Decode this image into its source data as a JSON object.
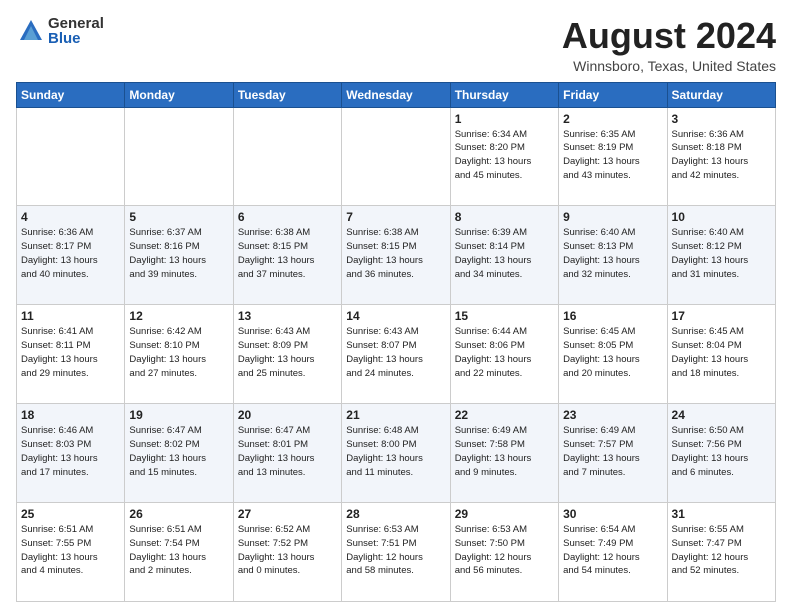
{
  "logo": {
    "general": "General",
    "blue": "Blue"
  },
  "title": "August 2024",
  "location": "Winnsboro, Texas, United States",
  "weekdays": [
    "Sunday",
    "Monday",
    "Tuesday",
    "Wednesday",
    "Thursday",
    "Friday",
    "Saturday"
  ],
  "weeks": [
    [
      {
        "day": "",
        "info": ""
      },
      {
        "day": "",
        "info": ""
      },
      {
        "day": "",
        "info": ""
      },
      {
        "day": "",
        "info": ""
      },
      {
        "day": "1",
        "info": "Sunrise: 6:34 AM\nSunset: 8:20 PM\nDaylight: 13 hours\nand 45 minutes."
      },
      {
        "day": "2",
        "info": "Sunrise: 6:35 AM\nSunset: 8:19 PM\nDaylight: 13 hours\nand 43 minutes."
      },
      {
        "day": "3",
        "info": "Sunrise: 6:36 AM\nSunset: 8:18 PM\nDaylight: 13 hours\nand 42 minutes."
      }
    ],
    [
      {
        "day": "4",
        "info": "Sunrise: 6:36 AM\nSunset: 8:17 PM\nDaylight: 13 hours\nand 40 minutes."
      },
      {
        "day": "5",
        "info": "Sunrise: 6:37 AM\nSunset: 8:16 PM\nDaylight: 13 hours\nand 39 minutes."
      },
      {
        "day": "6",
        "info": "Sunrise: 6:38 AM\nSunset: 8:15 PM\nDaylight: 13 hours\nand 37 minutes."
      },
      {
        "day": "7",
        "info": "Sunrise: 6:38 AM\nSunset: 8:15 PM\nDaylight: 13 hours\nand 36 minutes."
      },
      {
        "day": "8",
        "info": "Sunrise: 6:39 AM\nSunset: 8:14 PM\nDaylight: 13 hours\nand 34 minutes."
      },
      {
        "day": "9",
        "info": "Sunrise: 6:40 AM\nSunset: 8:13 PM\nDaylight: 13 hours\nand 32 minutes."
      },
      {
        "day": "10",
        "info": "Sunrise: 6:40 AM\nSunset: 8:12 PM\nDaylight: 13 hours\nand 31 minutes."
      }
    ],
    [
      {
        "day": "11",
        "info": "Sunrise: 6:41 AM\nSunset: 8:11 PM\nDaylight: 13 hours\nand 29 minutes."
      },
      {
        "day": "12",
        "info": "Sunrise: 6:42 AM\nSunset: 8:10 PM\nDaylight: 13 hours\nand 27 minutes."
      },
      {
        "day": "13",
        "info": "Sunrise: 6:43 AM\nSunset: 8:09 PM\nDaylight: 13 hours\nand 25 minutes."
      },
      {
        "day": "14",
        "info": "Sunrise: 6:43 AM\nSunset: 8:07 PM\nDaylight: 13 hours\nand 24 minutes."
      },
      {
        "day": "15",
        "info": "Sunrise: 6:44 AM\nSunset: 8:06 PM\nDaylight: 13 hours\nand 22 minutes."
      },
      {
        "day": "16",
        "info": "Sunrise: 6:45 AM\nSunset: 8:05 PM\nDaylight: 13 hours\nand 20 minutes."
      },
      {
        "day": "17",
        "info": "Sunrise: 6:45 AM\nSunset: 8:04 PM\nDaylight: 13 hours\nand 18 minutes."
      }
    ],
    [
      {
        "day": "18",
        "info": "Sunrise: 6:46 AM\nSunset: 8:03 PM\nDaylight: 13 hours\nand 17 minutes."
      },
      {
        "day": "19",
        "info": "Sunrise: 6:47 AM\nSunset: 8:02 PM\nDaylight: 13 hours\nand 15 minutes."
      },
      {
        "day": "20",
        "info": "Sunrise: 6:47 AM\nSunset: 8:01 PM\nDaylight: 13 hours\nand 13 minutes."
      },
      {
        "day": "21",
        "info": "Sunrise: 6:48 AM\nSunset: 8:00 PM\nDaylight: 13 hours\nand 11 minutes."
      },
      {
        "day": "22",
        "info": "Sunrise: 6:49 AM\nSunset: 7:58 PM\nDaylight: 13 hours\nand 9 minutes."
      },
      {
        "day": "23",
        "info": "Sunrise: 6:49 AM\nSunset: 7:57 PM\nDaylight: 13 hours\nand 7 minutes."
      },
      {
        "day": "24",
        "info": "Sunrise: 6:50 AM\nSunset: 7:56 PM\nDaylight: 13 hours\nand 6 minutes."
      }
    ],
    [
      {
        "day": "25",
        "info": "Sunrise: 6:51 AM\nSunset: 7:55 PM\nDaylight: 13 hours\nand 4 minutes."
      },
      {
        "day": "26",
        "info": "Sunrise: 6:51 AM\nSunset: 7:54 PM\nDaylight: 13 hours\nand 2 minutes."
      },
      {
        "day": "27",
        "info": "Sunrise: 6:52 AM\nSunset: 7:52 PM\nDaylight: 13 hours\nand 0 minutes."
      },
      {
        "day": "28",
        "info": "Sunrise: 6:53 AM\nSunset: 7:51 PM\nDaylight: 12 hours\nand 58 minutes."
      },
      {
        "day": "29",
        "info": "Sunrise: 6:53 AM\nSunset: 7:50 PM\nDaylight: 12 hours\nand 56 minutes."
      },
      {
        "day": "30",
        "info": "Sunrise: 6:54 AM\nSunset: 7:49 PM\nDaylight: 12 hours\nand 54 minutes."
      },
      {
        "day": "31",
        "info": "Sunrise: 6:55 AM\nSunset: 7:47 PM\nDaylight: 12 hours\nand 52 minutes."
      }
    ]
  ]
}
